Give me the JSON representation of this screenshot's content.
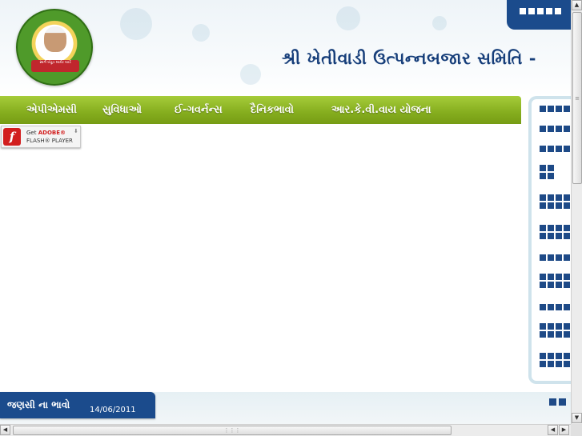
{
  "header": {
    "title": "શ્રી ખેતીવાડી ઉત્પન્નબજાર સમિતિ -",
    "logo_text": "સ્વર્ગ ખેડૂત માર્કેટ યાર્ડ"
  },
  "nav": {
    "items": [
      {
        "label": "એપીએમસી",
        "name": "nav-item-apmc"
      },
      {
        "label": "સુવિધાઓ",
        "name": "nav-item-facilities"
      },
      {
        "label": "ઈ-ગવર્નન્સ",
        "name": "nav-item-e-governance"
      },
      {
        "label": "દૈનિકભાવો",
        "name": "nav-item-daily-prices"
      },
      {
        "label": "આર.કે.વી.વાય યોજના",
        "name": "nav-item-rkvy-scheme"
      }
    ]
  },
  "flash": {
    "get": "Get",
    "brand": "ADOBE®",
    "player": "FLASH® PLAYER",
    "icon": "flash-icon"
  },
  "bottom": {
    "label": "જણસી ના ભાવો",
    "date": "14/06/2011"
  },
  "colors": {
    "nav_green": "#85ad1e",
    "brand_blue": "#1b4b8c",
    "title_blue": "#163e7a",
    "flash_red": "#d21e1e"
  },
  "icons": {
    "scroll_up": "▲",
    "scroll_down": "▼",
    "scroll_left": "◀",
    "scroll_right": "▶"
  }
}
